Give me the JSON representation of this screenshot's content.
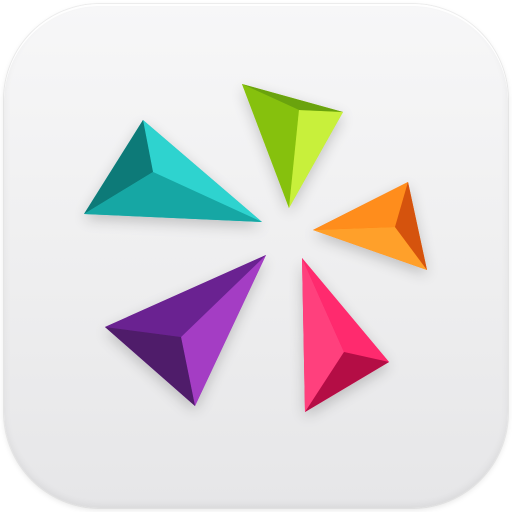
{
  "app_icon": {
    "name": "app-icon",
    "background": "#efeff0",
    "logo": {
      "name": "pinwheel-triangles-logo",
      "pieces": [
        {
          "name": "teal-triangle",
          "colors": {
            "light": "#2fd3cf",
            "mid": "#1db6b3",
            "dark": "#0c7a78"
          }
        },
        {
          "name": "lime-triangle",
          "colors": {
            "light": "#c8f03a",
            "mid": "#9fd31b",
            "dark": "#6aa30f"
          }
        },
        {
          "name": "orange-triangle",
          "colors": {
            "light": "#ffa02a",
            "mid": "#ff7a12",
            "dark": "#d55208"
          }
        },
        {
          "name": "pink-triangle",
          "colors": {
            "light": "#ff3f7d",
            "mid": "#f31d63",
            "dark": "#b40e45"
          }
        },
        {
          "name": "purple-triangle",
          "colors": {
            "light": "#a43cc4",
            "mid": "#7c2aa4",
            "dark": "#4f1a6b"
          }
        }
      ]
    }
  }
}
